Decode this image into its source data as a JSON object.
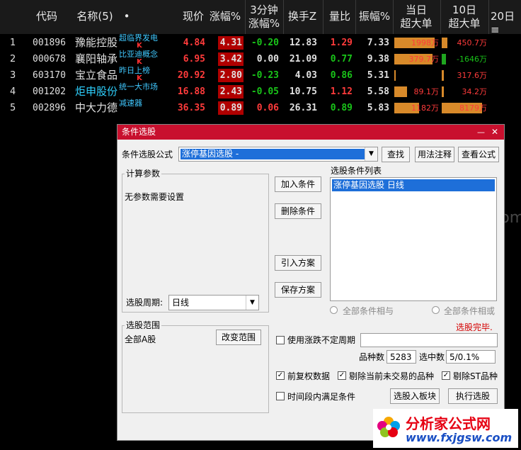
{
  "headers": {
    "code": "代码",
    "name": "名称(5)",
    "dot": "•",
    "price": "现价",
    "change_pct": "涨幅%",
    "change3m_l1": "3分钟",
    "change3m_l2": "涨幅%",
    "turnover": "换手Z",
    "vol_ratio": "量比",
    "amplitude": "振幅%",
    "today_big_l1": "当日",
    "today_big_l2": "超大单",
    "big10_l1": "10日",
    "big10_l2": "超大单",
    "day20": "20日≡"
  },
  "rows": [
    {
      "idx": "1",
      "code": "001896",
      "name": "豫能控股",
      "tag": "超临界发电",
      "k": "K",
      "price": "4.84",
      "chg": "4.31",
      "chg3": "-0.20",
      "turn": "12.83",
      "vr": "1.29",
      "amp": "7.33",
      "today": "1998万",
      "today_bar": 0.9,
      "big10": "450.7万",
      "big10_bar": 0.12
    },
    {
      "idx": "2",
      "code": "000678",
      "name": "襄阳轴承",
      "tag": "比亚迪概念",
      "k": "K",
      "price": "6.95",
      "chg": "3.42",
      "chg3": "0.00",
      "turn": "21.09",
      "vr": "0.77",
      "amp": "9.38",
      "today": "379.7万",
      "today_bar": 0.85,
      "big10": "-1646万",
      "big10_bar": 0.1
    },
    {
      "idx": "3",
      "code": "603170",
      "name": "宝立食品",
      "tag": "昨日上榜",
      "k": "K",
      "price": "20.92",
      "chg": "2.80",
      "chg3": "-0.23",
      "turn": "4.03",
      "vr": "0.86",
      "amp": "5.31",
      "today": "",
      "today_bar": 0.03,
      "big10": "317.6万",
      "big10_bar": 0.05
    },
    {
      "idx": "4",
      "code": "001202",
      "name": "炬申股份",
      "tag": "统一大市场",
      "k": "",
      "price": "16.88",
      "chg": "2.43",
      "chg3": "-0.05",
      "turn": "10.75",
      "vr": "1.12",
      "amp": "5.58",
      "today": "89.1万",
      "today_bar": 0.28,
      "big10": "34.2万",
      "big10_bar": 0.05
    },
    {
      "idx": "5",
      "code": "002896",
      "name": "中大力德",
      "tag": "减速器",
      "k": "",
      "price": "36.35",
      "chg": "0.89",
      "chg3": "0.06",
      "turn": "26.31",
      "vr": "0.89",
      "amp": "5.83",
      "today": "1182万",
      "today_bar": 0.55,
      "big10": "8179万",
      "big10_bar": 0.9
    }
  ],
  "dialog": {
    "title": "条件选股",
    "minimize": "—",
    "close": "✕",
    "formula_label": "条件选股公式",
    "formula_value": "涨停基因选股 -",
    "btn_find": "查找",
    "btn_usage": "用法注释",
    "btn_view": "查看公式",
    "params_label": "计算参数",
    "params_text": "无参数需要设置",
    "period_label": "选股周期:",
    "period_value": "日线",
    "scope_label": "选股范围",
    "scope_value": "全部A股",
    "btn_change_scope": "改变范围",
    "btn_add": "加入条件",
    "btn_delete": "删除条件",
    "btn_import": "引入方案",
    "btn_save": "保存方案",
    "list_label": "选股条件列表",
    "list_item": "涨停基因选股  日线",
    "radio_and": "全部条件相与",
    "radio_or": "全部条件相或",
    "status": "选股完毕.",
    "use_period_label": "使用涨跌不定周期",
    "count_label": "品种数",
    "count_value": "5283",
    "selected_label": "选中数",
    "selected_value": "5/0.1%",
    "chk_adjust": "前复权数据",
    "chk_exclude_untraded": "剔除当前未交易的品种",
    "chk_exclude_st": "剔除ST品种",
    "chk_time_range": "时间段内满足条件",
    "btn_to_board": "选股入板块",
    "btn_execute": "执行选股"
  },
  "watermark": {
    "text1": "www.fxjgsw.com",
    "text2": "分析家公式网"
  },
  "logo": {
    "title": "分析家公式网",
    "url": "www.fxjgsw.com"
  },
  "colors": {
    "up": "#ff3b3b",
    "down": "#19c419",
    "dialog_title": "#c8102e",
    "selection": "#1e6fd9",
    "status": "#d40000"
  }
}
